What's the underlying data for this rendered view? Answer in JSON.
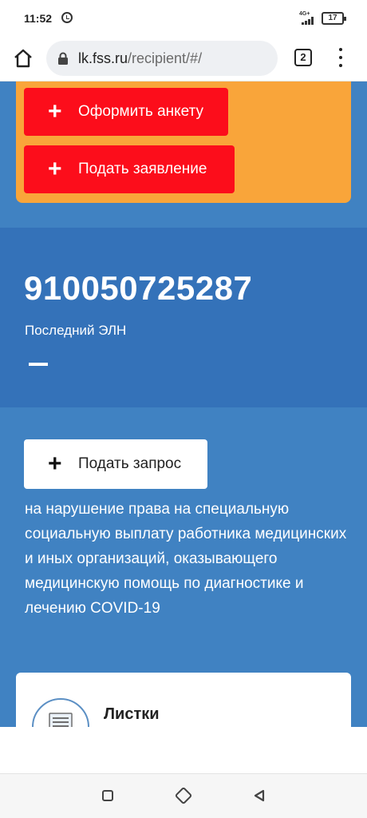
{
  "status_bar": {
    "time": "11:52",
    "network": "4G+",
    "battery": "17",
    "icons": [
      "alarm-icon",
      "signal-icon",
      "battery-icon"
    ]
  },
  "browser": {
    "url_host": "lk.fss.ru",
    "url_path": "/recipient/#/",
    "tabs_count": "2",
    "icons": [
      "home-icon",
      "lock-icon",
      "tabs-icon",
      "more-vert-icon"
    ]
  },
  "actions": {
    "fill_form_label": "Оформить анкету",
    "submit_application_label": "Подать заявление",
    "submit_request_label": "Подать запрос",
    "plus_symbol": "+"
  },
  "eln": {
    "number": "910050725287",
    "label": "Последний ЭЛН"
  },
  "request": {
    "description": "на нарушение права на специальную социальную выплату работника медицинских и иных организаций, оказывающего медицинскую помощь по диагностике и лечению COVID-19"
  },
  "sick_leave_card": {
    "title": "Листки нетрудоспособности",
    "icon": "document-icon"
  },
  "nav_bar": {
    "icons": [
      "recents-icon",
      "home-icon",
      "back-icon"
    ]
  },
  "colors": {
    "page_blue": "#4082c2",
    "eln_blue": "#3472b9",
    "orange": "#f9a53a",
    "red": "#fc0d1b"
  }
}
